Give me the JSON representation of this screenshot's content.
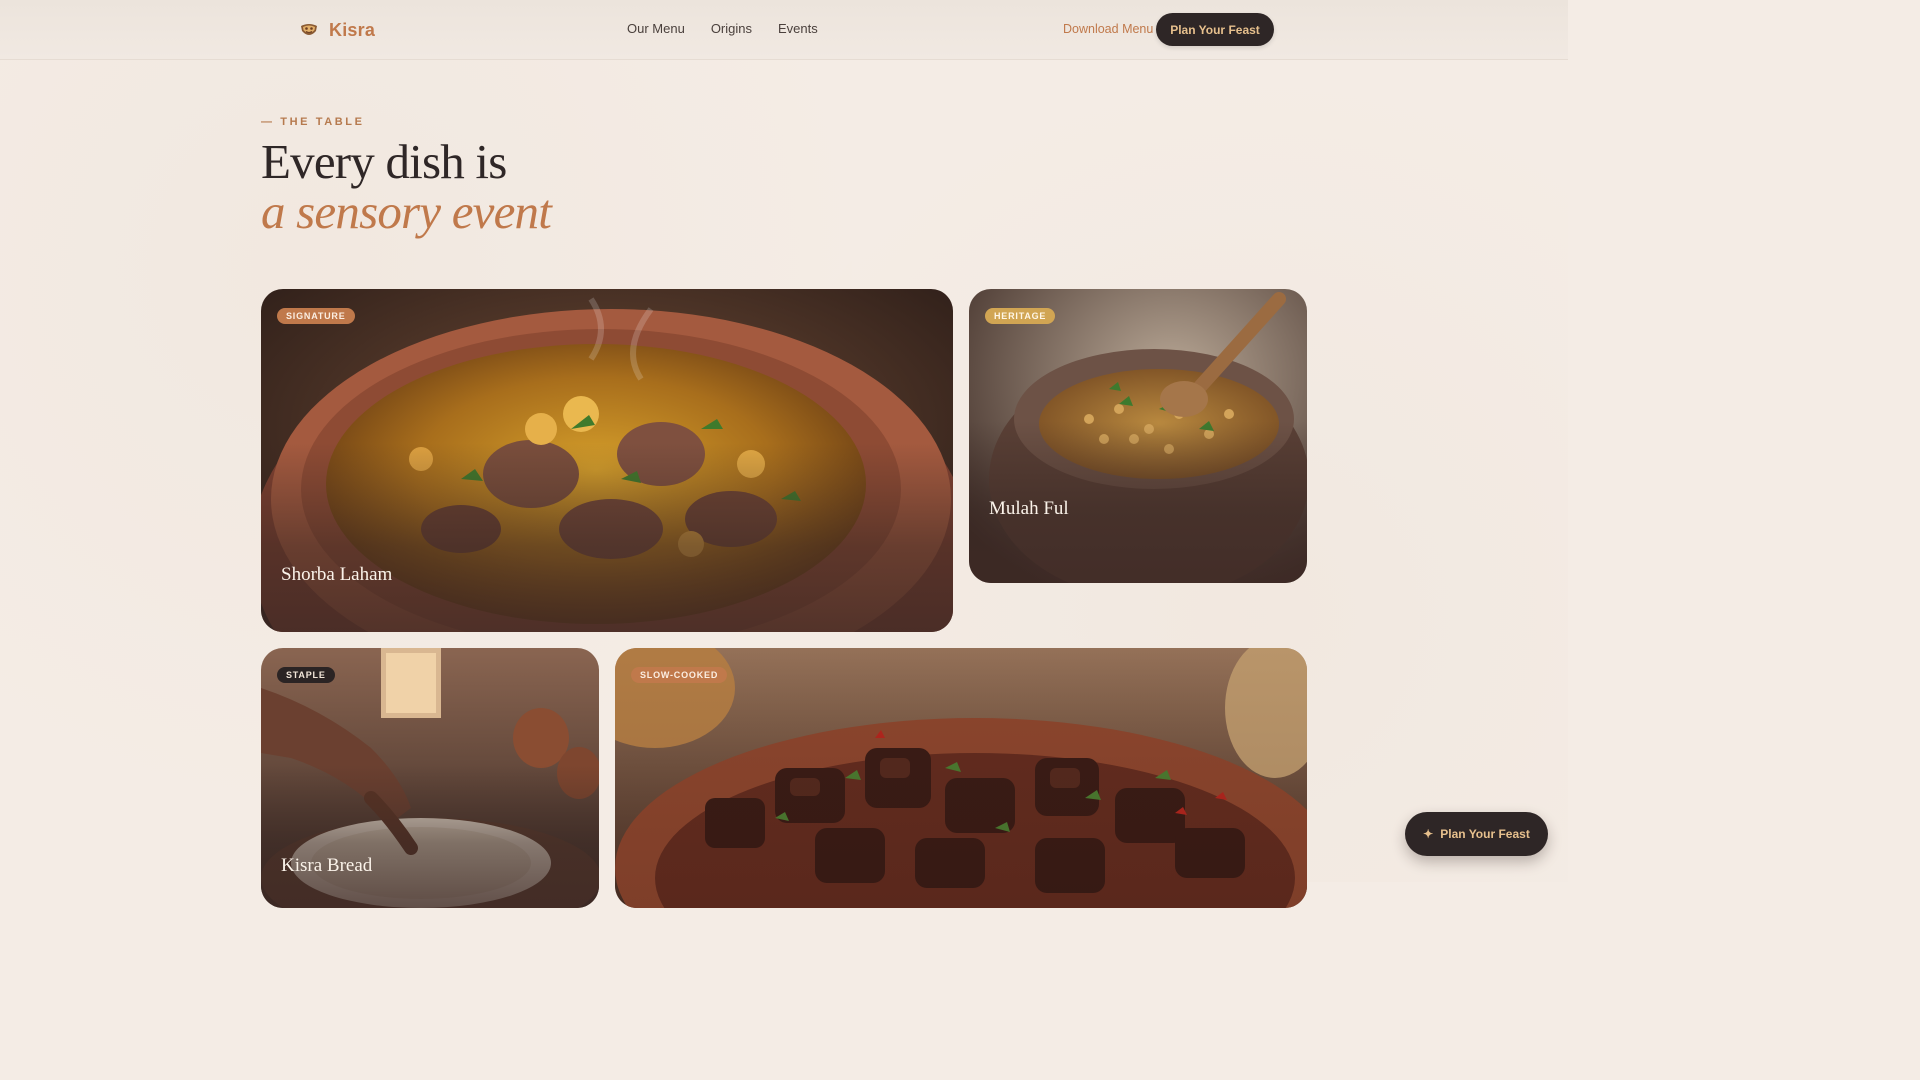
{
  "nav": {
    "brand": "Kisra",
    "links": [
      "Our Menu",
      "Origins",
      "Events"
    ],
    "download_label": "Download Menu",
    "cta_label": "Plan Your Feast"
  },
  "hero": {
    "eyebrow": "— THE TABLE",
    "headline": "Every dish is",
    "headline_accent": "a sensory event"
  },
  "dishes": [
    {
      "badge": "SIGNATURE",
      "name": "Shorba Laham"
    },
    {
      "badge": "HERITAGE",
      "name": "Mulah Ful"
    },
    {
      "badge": "STAPLE",
      "name": "Kisra Bread"
    },
    {
      "badge": "SLOW-COOKED",
      "name": ""
    }
  ],
  "floating_cta": {
    "label": "Plan Your Feast",
    "icon": "sparkle-icon"
  },
  "colors": {
    "background": "#f4ece5",
    "accent": "#c0794b",
    "dark": "#2e2626",
    "gold": "#e7c08d"
  }
}
